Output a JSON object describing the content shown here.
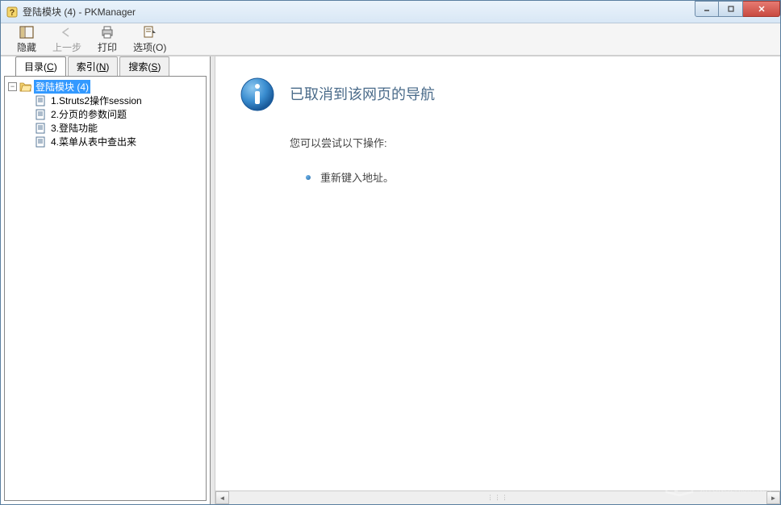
{
  "titlebar": {
    "title": "登陆模块 (4) - PKManager"
  },
  "toolbar": {
    "hide": "隐藏",
    "back": "上一步",
    "print": "打印",
    "options": "选项(O)"
  },
  "tabs": {
    "contents": {
      "label": "目录",
      "key": "C"
    },
    "index": {
      "label": "索引",
      "key": "N"
    },
    "search": {
      "label": "搜索",
      "key": "S"
    }
  },
  "tree": {
    "root": "登陆模块 (4)",
    "children": [
      "1.Struts2操作session",
      "2.分页的参数问题",
      "3.登陆功能",
      "4.菜单从表中查出来"
    ]
  },
  "content": {
    "title": "已取消到该网页的导航",
    "subtitle": "您可以尝试以下操作:",
    "item1": "重新键入地址。"
  },
  "watermark": {
    "cn": "系统之家",
    "en": "XITONGZHIJIA.NET"
  }
}
